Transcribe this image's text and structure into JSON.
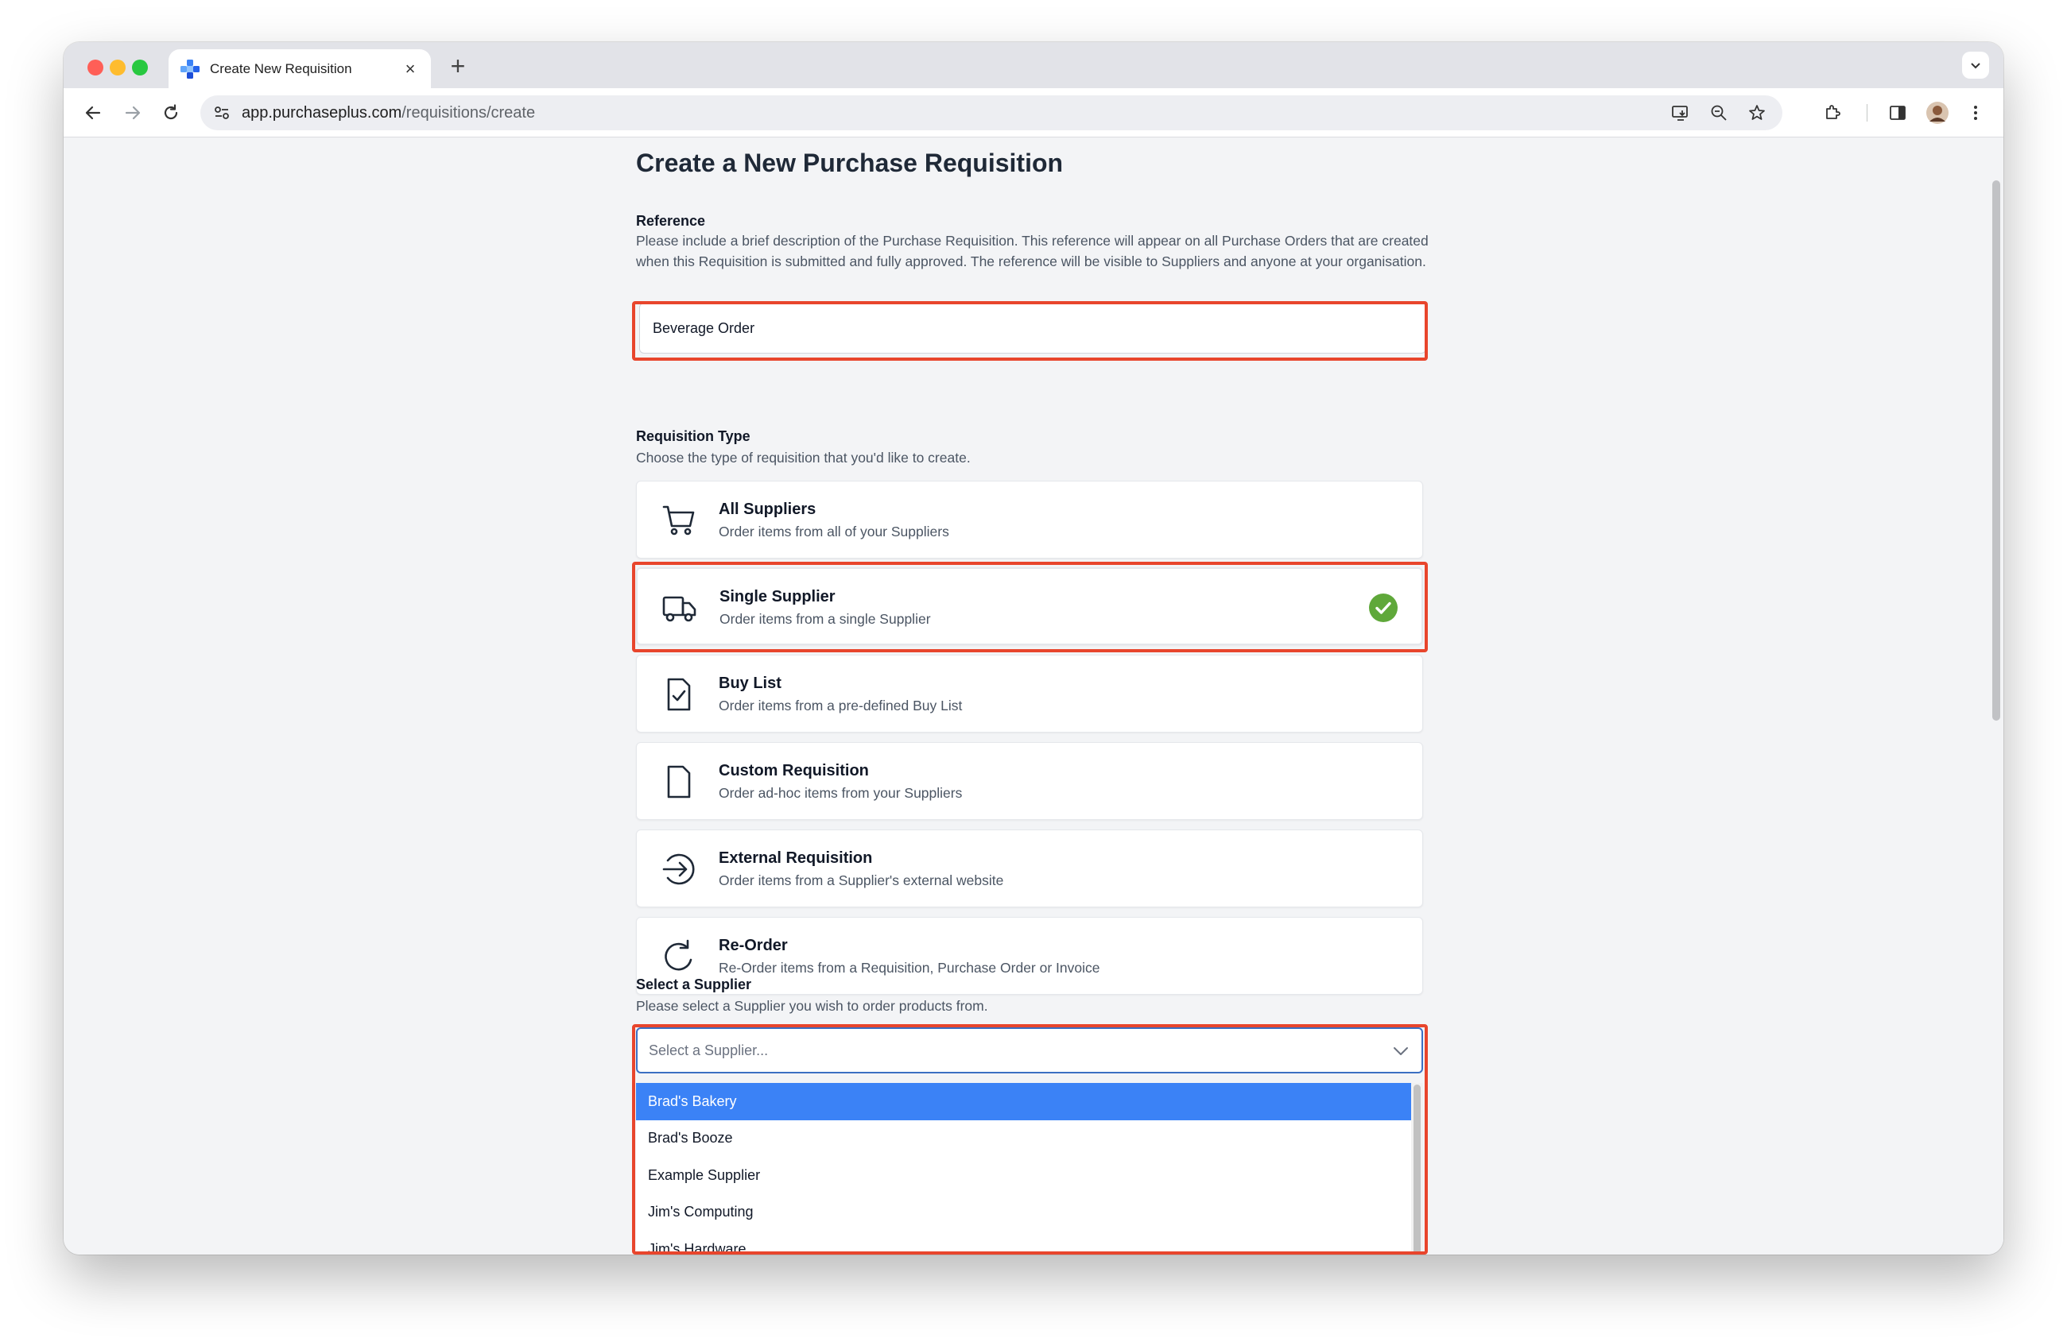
{
  "browser": {
    "tab_title": "Create New Requisition",
    "new_tab_label": "+",
    "tab_close_label": "×",
    "url_host": "app.purchaseplus.com",
    "url_path": "/requisitions/create"
  },
  "page": {
    "title": "Create a New Purchase Requisition",
    "reference": {
      "label": "Reference",
      "description": "Please include a brief description of the Purchase Requisition. This reference will appear on all Purchase Orders that are created when this Requisition is submitted and fully approved. The reference will be visible to Suppliers and anyone at your organisation.",
      "value": "Beverage Order"
    },
    "requisition_type": {
      "label": "Requisition Type",
      "description": "Choose the type of requisition that you'd like to create.",
      "options": [
        {
          "title": "All Suppliers",
          "subtitle": "Order items from all of your Suppliers",
          "icon": "cart-icon",
          "selected": false
        },
        {
          "title": "Single Supplier",
          "subtitle": "Order items from a single Supplier",
          "icon": "truck-icon",
          "selected": true
        },
        {
          "title": "Buy List",
          "subtitle": "Order items from a pre-defined Buy List",
          "icon": "document-check-icon",
          "selected": false
        },
        {
          "title": "Custom Requisition",
          "subtitle": "Order ad-hoc items from your Suppliers",
          "icon": "document-icon",
          "selected": false
        },
        {
          "title": "External Requisition",
          "subtitle": "Order items from a Supplier's external website",
          "icon": "arrow-right-circle-icon",
          "selected": false
        },
        {
          "title": "Re-Order",
          "subtitle": "Re-Order items from a Requisition, Purchase Order or Invoice",
          "icon": "refresh-icon",
          "selected": false
        }
      ]
    },
    "supplier": {
      "label": "Select a Supplier",
      "description": "Please select a Supplier you wish to order products from.",
      "placeholder": "Select a Supplier...",
      "options": [
        "Brad's Bakery",
        "Brad's Booze",
        "Example Supplier",
        "Jim's Computing",
        "Jim's Hardware"
      ],
      "highlighted_option": "Brad's Bakery"
    }
  },
  "colors": {
    "highlight_outline": "#e8452c",
    "check_green": "#5fa83a",
    "option_active": "#3b82f6",
    "select_border": "#3b6fc2"
  }
}
